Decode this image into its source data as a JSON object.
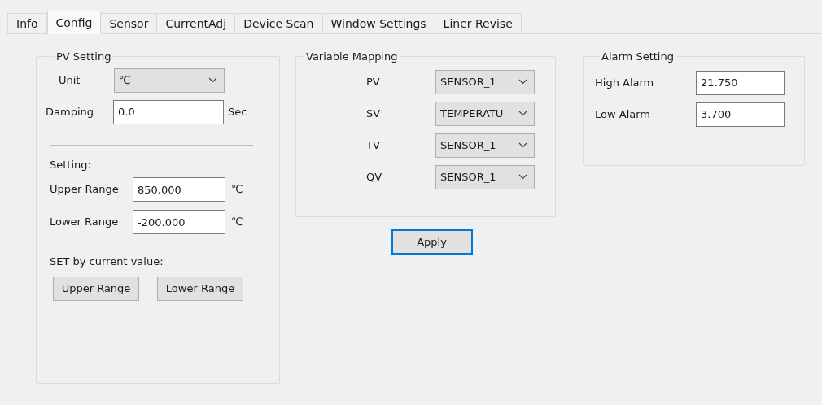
{
  "tabs": [
    {
      "label": "Info",
      "selected": false
    },
    {
      "label": "Config",
      "selected": true
    },
    {
      "label": "Sensor",
      "selected": false
    },
    {
      "label": "CurrentAdj",
      "selected": false
    },
    {
      "label": "Device Scan",
      "selected": false
    },
    {
      "label": "Window Settings",
      "selected": false
    },
    {
      "label": "Liner Revise",
      "selected": false
    }
  ],
  "pv_setting": {
    "title": "PV Setting",
    "unit_label": "Unit",
    "unit_value": "℃",
    "damping_label": "Damping",
    "damping_value": "0.0",
    "damping_unit": "Sec",
    "setting_label": "Setting:",
    "ranges": [
      {
        "label": "Upper Range",
        "value": "850.000",
        "unit": "℃"
      },
      {
        "label": "Lower Range",
        "value": "-200.000",
        "unit": "℃"
      }
    ],
    "set_label": "SET by current value:",
    "buttons": [
      "Upper Range",
      "Lower Range"
    ]
  },
  "variable_mapping": {
    "title": "Variable Mapping",
    "rows": [
      {
        "label": "PV",
        "value": "SENSOR_1"
      },
      {
        "label": "SV",
        "value": "TEMPERATU"
      },
      {
        "label": "TV",
        "value": "SENSOR_1"
      },
      {
        "label": "QV",
        "value": "SENSOR_1"
      }
    ]
  },
  "apply_button": "Apply",
  "alarm_setting": {
    "title": "Alarm Setting",
    "rows": [
      {
        "label": "High Alarm",
        "value": "21.750"
      },
      {
        "label": "Low Alarm",
        "value": "3.700"
      }
    ]
  }
}
